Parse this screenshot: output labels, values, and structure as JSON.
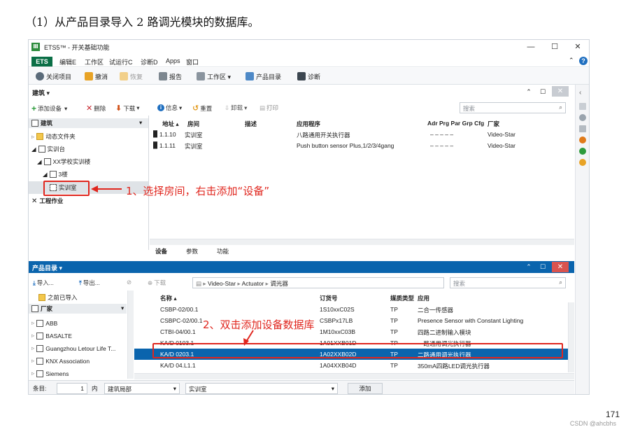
{
  "heading": "（1）从产品目录导入 2 路调光模块的数据库。",
  "window": {
    "logo": "Ⅲ",
    "title": "ETS5™ - 开关基础功能",
    "minimize": "—",
    "maximize": "☐",
    "close": "✕"
  },
  "menu": {
    "ets": "ETS",
    "items": [
      "编辑E",
      "工作区",
      "试运行C",
      "诊断D",
      "Apps",
      "窗口"
    ],
    "collapse": "⌃",
    "help": "?"
  },
  "toolbar": {
    "close_project": "关闭项目",
    "undo": "撤消",
    "redo": "恢复",
    "report": "报告",
    "workspace": "工作区 ▾",
    "catalog": "产品目录",
    "diagnostics": "诊断"
  },
  "building_panel": {
    "title": "建筑 ▾",
    "ctrl_up": "⌃",
    "ctrl_restore": "☐",
    "ctrl_close": "✕",
    "actions": {
      "add_device": "添加设备",
      "delete": "删除",
      "download": "下载",
      "info": "信息",
      "reset": "重置",
      "unload": "卸载",
      "print": "打印"
    },
    "search_placeholder": "搜索",
    "tree": {
      "root": "建筑",
      "dynamic_folder": "动态文件夹",
      "training_platform": "实训台",
      "school_building": "XX学校实训楼",
      "floor": "3楼",
      "room": "实训室",
      "trades": "工程作业"
    },
    "columns": {
      "address": "地址 ▴",
      "room": "房间",
      "description": "描述",
      "application": "应用程序",
      "flags": "Adr Prg Par Grp Cfg",
      "manufacturer": "厂家"
    },
    "rows": [
      {
        "address": "1.1.10",
        "room": "实训室",
        "description": "",
        "application": "八路通用开关执行器",
        "flags": "–    –    –    –    –",
        "manufacturer": "Video-Star"
      },
      {
        "address": "1.1.11",
        "room": "实训室",
        "description": "",
        "application": "Push button sensor Plus,1/2/3/4gang",
        "flags": "–    –    –    –    –",
        "manufacturer": "Video-Star"
      }
    ],
    "tabs": [
      "设备",
      "参数",
      "功能"
    ]
  },
  "annotations": {
    "step1": "1、选择房间，右击添加“设备”",
    "step2": "2、双击添加设备数据库"
  },
  "catalog_panel": {
    "title": "产品目录 ▾",
    "ctrl_up": "⌃",
    "ctrl_restore": "☐",
    "ctrl_close": "✕",
    "actions": {
      "import": "导入...",
      "export": "导出...",
      "download": "下载"
    },
    "breadcrumb": [
      "Video-Star",
      "Actuator",
      "调光器"
    ],
    "search_placeholder": "搜索",
    "tree": {
      "previously_imported": "之前已导入",
      "manufacturer_header": "厂家",
      "manufacturers": [
        "ABB",
        "BASALTE",
        "Guangzhou Letour Life T...",
        "KNX Association",
        "Siemens"
      ]
    },
    "columns": {
      "name": "名称 ▴",
      "order_no": "订货号",
      "medium": "媒质类型",
      "application": "应用"
    },
    "rows": [
      {
        "name": "CSBP-02/00.1",
        "order_no": "1S10xxC02S",
        "medium": "TP",
        "application": "二合一传感器"
      },
      {
        "name": "CSBPC-02/00.1",
        "order_no": "CSBPx17LB",
        "medium": "TP",
        "application": "Presence Sensor with Constant Lighting"
      },
      {
        "name": "CTBI-04/00.1",
        "order_no": "1M10xxC03B",
        "medium": "TP",
        "application": "四路二进制输入模块"
      },
      {
        "name": "KA/D 0103.1",
        "order_no": "1A01XXB01D",
        "medium": "TP",
        "application": "一路通用调光执行器"
      },
      {
        "name": "KA/D 0203.1",
        "order_no": "1A02XXB02D",
        "medium": "TP",
        "application": "二路通用调光执行器"
      },
      {
        "name": "KA/D 04.L1.1",
        "order_no": "1A04XXB04D",
        "medium": "TP",
        "application": "350mA四路LED调光执行器"
      }
    ],
    "status": {
      "items_label": "条目:",
      "items_value": "1",
      "in_label": "内",
      "scope": "建筑局部",
      "room": "实训室",
      "add_button": "添加"
    }
  },
  "page_number": "171",
  "watermark": "CSDN @ahcbhs",
  "colors": {
    "accent_blue": "#0a64ad",
    "ets_green": "#0b6f46",
    "annotation_red": "#e0261e"
  }
}
